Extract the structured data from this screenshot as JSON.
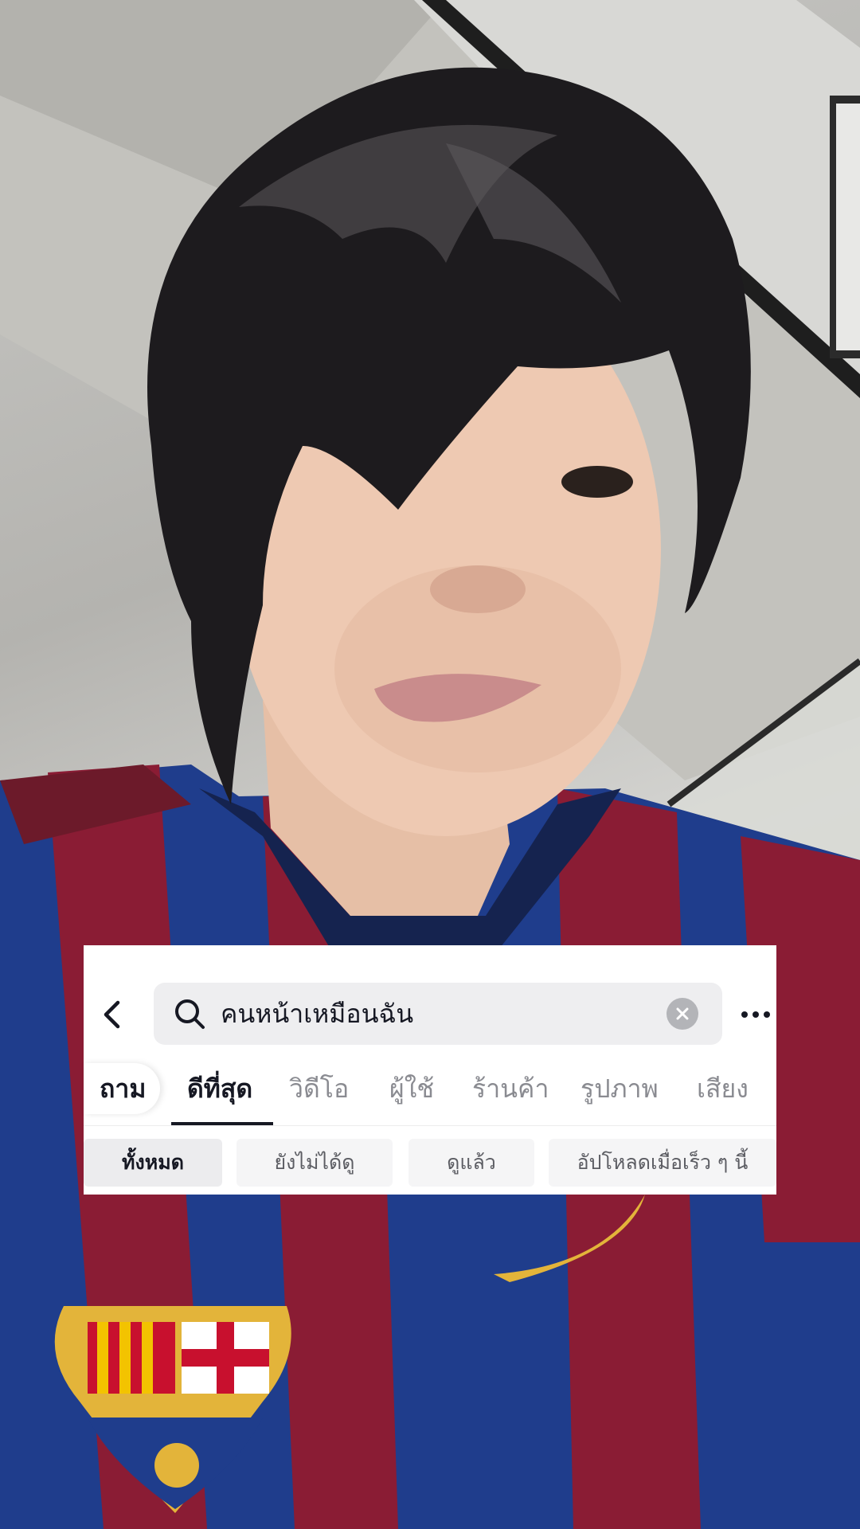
{
  "search": {
    "query": "คนหน้าเหมือนฉัน"
  },
  "tabs": [
    {
      "label": "ถาม"
    },
    {
      "label": "ดีที่สุด"
    },
    {
      "label": "วิดีโอ"
    },
    {
      "label": "ผู้ใช้"
    },
    {
      "label": "ร้านค้า"
    },
    {
      "label": "รูปภาพ"
    },
    {
      "label": "เสียง"
    }
  ],
  "active_tab": "ดีที่สุด",
  "filters": [
    {
      "label": "ทั้งหมด"
    },
    {
      "label": "ยังไม่ได้ดู"
    },
    {
      "label": "ดูแล้ว"
    },
    {
      "label": "อัปโหลดเมื่อเร็ว ๆ นี้"
    }
  ],
  "selected_filter": "ทั้งหมด",
  "icons": {
    "back": "chevron-left-icon",
    "search": "search-icon",
    "clear": "clear-icon",
    "more": "more-horizontal-icon"
  },
  "colors": {
    "card_background": "#ffffff",
    "search_field": "#eeeef0",
    "text_primary": "#161823",
    "text_secondary": "#8a8b91",
    "jersey_blue": "#1f3d8c",
    "jersey_red": "#8a1c34"
  }
}
